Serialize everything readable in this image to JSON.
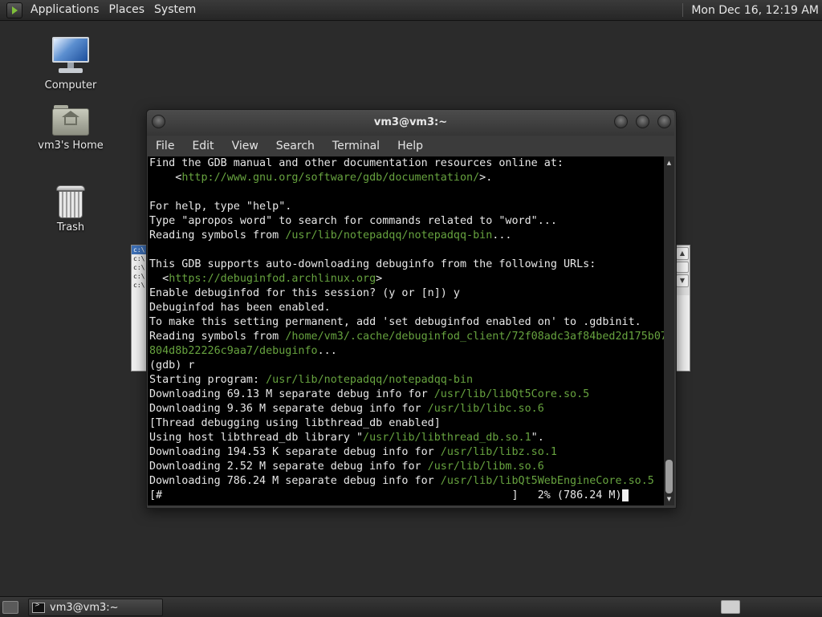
{
  "top_panel": {
    "menus": [
      "Applications",
      "Places",
      "System"
    ],
    "clock": "Mon Dec 16, 12:19 AM"
  },
  "desktop_icons": [
    {
      "label": "Computer",
      "icon": "computer-icon"
    },
    {
      "label": "vm3's Home",
      "icon": "home-folder-icon"
    },
    {
      "label": "Trash",
      "icon": "trash-icon"
    }
  ],
  "terminal": {
    "title": "vm3@vm3:~",
    "menus": [
      "File",
      "Edit",
      "View",
      "Search",
      "Terminal",
      "Help"
    ],
    "lines": [
      [
        {
          "t": "Find the GDB manual and other documentation resources online at:"
        }
      ],
      [
        {
          "t": "    <"
        },
        {
          "t": "http://www.gnu.org/software/gdb/documentation/",
          "p": true
        },
        {
          "t": ">."
        }
      ],
      [
        {
          "t": ""
        }
      ],
      [
        {
          "t": "For help, type \"help\"."
        }
      ],
      [
        {
          "t": "Type \"apropos word\" to search for commands related to \"word\"..."
        }
      ],
      [
        {
          "t": "Reading symbols from "
        },
        {
          "t": "/usr/lib/notepadqq/notepadqq-bin",
          "p": true
        },
        {
          "t": "..."
        }
      ],
      [
        {
          "t": ""
        }
      ],
      [
        {
          "t": "This GDB supports auto-downloading debuginfo from the following URLs:"
        }
      ],
      [
        {
          "t": "  <"
        },
        {
          "t": "https://debuginfod.archlinux.org",
          "p": true
        },
        {
          "t": ">"
        }
      ],
      [
        {
          "t": "Enable debuginfod for this session? (y or [n]) y"
        }
      ],
      [
        {
          "t": "Debuginfod has been enabled."
        }
      ],
      [
        {
          "t": "To make this setting permanent, add 'set debuginfod enabled on' to .gdbinit."
        }
      ],
      [
        {
          "t": "Reading symbols from "
        },
        {
          "t": "/home/vm3/.cache/debuginfod_client/72f08adc3af84bed2d175b07",
          "p": true
        }
      ],
      [
        {
          "t": "804d8b22226c9aa7/debuginfo",
          "p": true
        },
        {
          "t": "..."
        }
      ],
      [
        {
          "t": "(gdb) r"
        }
      ],
      [
        {
          "t": "Starting program: "
        },
        {
          "t": "/usr/lib/notepadqq/notepadqq-bin",
          "p": true
        }
      ],
      [
        {
          "t": "Downloading 69.13 M separate debug info for "
        },
        {
          "t": "/usr/lib/libQt5Core.so.5",
          "p": true
        }
      ],
      [
        {
          "t": "Downloading 9.36 M separate debug info for "
        },
        {
          "t": "/usr/lib/libc.so.6",
          "p": true
        }
      ],
      [
        {
          "t": "[Thread debugging using libthread_db enabled]"
        }
      ],
      [
        {
          "t": "Using host libthread_db library \""
        },
        {
          "t": "/usr/lib/libthread_db.so.1",
          "p": true
        },
        {
          "t": "\"."
        }
      ],
      [
        {
          "t": "Downloading 194.53 K separate debug info for "
        },
        {
          "t": "/usr/lib/libz.so.1",
          "p": true
        }
      ],
      [
        {
          "t": "Downloading 2.52 M separate debug info for "
        },
        {
          "t": "/usr/lib/libm.so.6",
          "p": true
        }
      ],
      [
        {
          "t": "Downloading 786.24 M separate debug info for "
        },
        {
          "t": "/usr/lib/libQt5WebEngineCore.so.5",
          "p": true
        }
      ],
      [
        {
          "t": "[#                                                      ]   2% (786.24 M)"
        },
        {
          "t": " ",
          "c": true
        }
      ]
    ]
  },
  "background_window": {
    "list_items": [
      "c:\\",
      "c:\\",
      "c:\\",
      "c:\\",
      "c:\\"
    ]
  },
  "taskbar": {
    "task_label": "vm3@vm3:~"
  }
}
